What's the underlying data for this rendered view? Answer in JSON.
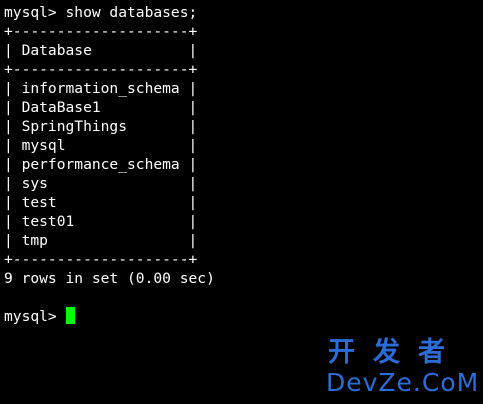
{
  "terminal": {
    "command_line": "mysql> show databases;",
    "table_border": "+--------------------+",
    "table_header": "| Database           |",
    "rows": [
      "| information_schema |",
      "| DataBase1          |",
      "| SpringThings       |",
      "| mysql              |",
      "| performance_schema |",
      "| sys                |",
      "| test               |",
      "| test01             |",
      "| tmp                |"
    ],
    "result_summary": "9 rows in set (0.00 sec)",
    "prompt": "mysql>",
    "cursor_color": "#00ff00"
  },
  "watermark": {
    "chinese": "开发者",
    "latin": "DevZe.CoM",
    "color": "#2a6dd8"
  }
}
